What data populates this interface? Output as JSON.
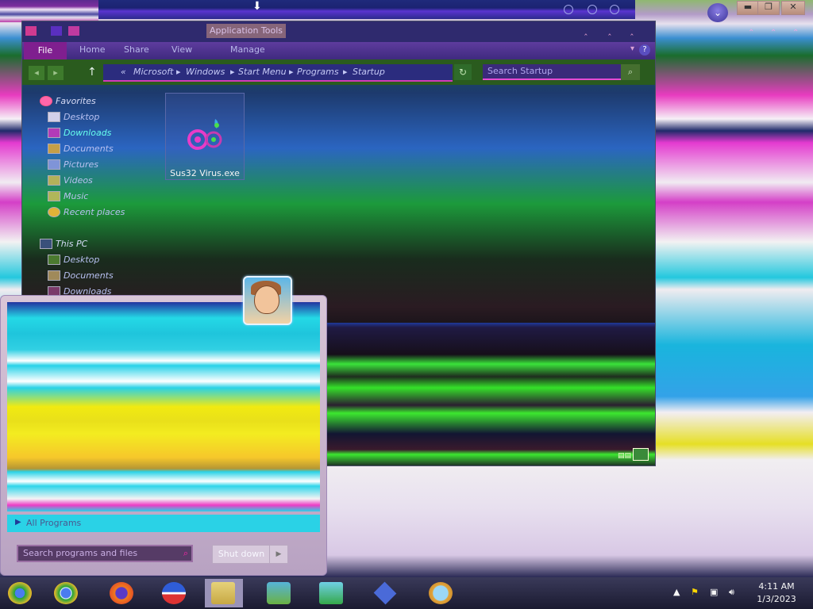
{
  "desktop": {
    "glitch_colors": [
      "#e43ad0",
      "#24c8de",
      "#e6df25",
      "#3ae23a"
    ]
  },
  "top_strip": {
    "download_icon": "download-arrow-icon"
  },
  "explorer": {
    "app_tools_label": "Application Tools",
    "ribbon_tabs": {
      "file": "File",
      "home": "Home",
      "share": "Share",
      "view": "View",
      "manage": "Manage"
    },
    "address": {
      "prefix": "«",
      "segments": [
        "Microsoft",
        "Windows",
        "Start Menu",
        "Programs",
        "Startup"
      ],
      "separator": "▸"
    },
    "search_placeholder": "Search Startup",
    "nav_pane": {
      "favorites_heading": "Favorites",
      "favorites": [
        "Desktop",
        "Downloads",
        "Documents",
        "Pictures",
        "Videos",
        "Music",
        "Recent places"
      ],
      "this_pc_heading": "This PC",
      "this_pc": [
        "Desktop",
        "Documents",
        "Downloads"
      ]
    },
    "file": {
      "name": "Sus32 Virus.exe",
      "icon": "gears-icon"
    }
  },
  "start_menu": {
    "all_programs": "All Programs",
    "search_placeholder": "Search programs and files",
    "shutdown_label": "Shut down"
  },
  "taskbar": {
    "apps": [
      "chrome-icon",
      "chrome-icon",
      "firefox-icon",
      "obama-logo-icon",
      "file-explorer-icon",
      "network-people-icon",
      "control-panel-icon",
      "vpn-diamond-icon",
      "magnifier-icon"
    ],
    "clock_time": "4:11 AM",
    "clock_date": "1/3/2023"
  },
  "colors": {
    "accent_magenta": "#d23bb8",
    "accent_green": "#3ae23a",
    "accent_cyan": "#24d9e6",
    "taskbar": "#2a2a44"
  }
}
